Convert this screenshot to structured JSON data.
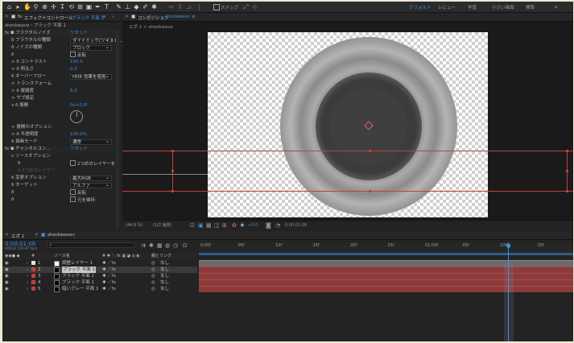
{
  "colors": {
    "accent": "#3a8ee6",
    "label_red": "#c04040",
    "label_white": "#e0e0e0",
    "bar": "#8c3a3a",
    "bar_top": "#6a6a6a"
  },
  "toolbar": {
    "snap_label": "スナップ",
    "workspaces": [
      "デフォルト",
      "レビュー",
      "学習",
      "小さい画面",
      "標準"
    ],
    "active_workspace_index": 0
  },
  "effect_controls": {
    "tab_label": "エフェクトコントロール",
    "tab_layer": "ブラック 平面 1",
    "breadcrumb": "shockwave・ブラック 平面 1",
    "rows": [
      {
        "indent": 0,
        "label": "fx 🞕 フラクタルノイズ",
        "value": "リセット",
        "type": "header"
      },
      {
        "indent": 1,
        "label": "ð フラクタルの種類",
        "value": "ダイナミック(ツイスト…",
        "type": "dropdown"
      },
      {
        "indent": 1,
        "label": "ð ノイズの種類",
        "value": "ブロック",
        "type": "dropdown"
      },
      {
        "indent": 1,
        "label": "ð",
        "value": "反転",
        "type": "checkbox"
      },
      {
        "indent": 1,
        "label": "> ð コントラスト",
        "value": "100.0",
        "type": "value"
      },
      {
        "indent": 1,
        "label": "> ð 明るさ",
        "value": "0.0",
        "type": "value"
      },
      {
        "indent": 1,
        "label": "ð オーバーフロー",
        "value": "HDR 効果を使用",
        "type": "dropdown"
      },
      {
        "indent": 1,
        "label": "> トランスフォーム",
        "value": "",
        "type": "group"
      },
      {
        "indent": 1,
        "label": "> ð 複雑度",
        "value": "6.0",
        "type": "value"
      },
      {
        "indent": 1,
        "label": "> サブ設定",
        "value": "",
        "type": "group"
      },
      {
        "indent": 1,
        "label": "v ð 展開",
        "value": "0x+0.0°",
        "type": "value"
      },
      {
        "indent": 1,
        "label": "",
        "value": "",
        "type": "dial"
      },
      {
        "indent": 1,
        "label": "> 展開のオプション",
        "value": "",
        "type": "group"
      },
      {
        "indent": 1,
        "label": "> ð 不透明度",
        "value": "100.0%",
        "type": "value"
      },
      {
        "indent": 1,
        "label": "ð 描画モード",
        "value": "通常",
        "type": "dropdown"
      },
      {
        "indent": 0,
        "label": "fx 🞕 チャンネルコン…",
        "value": "リセット",
        "type": "header"
      },
      {
        "indent": 1,
        "label": "v ソースオプション",
        "value": "",
        "type": "group"
      },
      {
        "indent": 2,
        "label": "ð",
        "value": "2つめのレイヤーを",
        "type": "checkbox"
      },
      {
        "indent": 2,
        "label": "ð 2つめのレイヤー",
        "value": "",
        "type": "disabled"
      },
      {
        "indent": 1,
        "label": "ð 変更オプション",
        "value": "最大RGB",
        "type": "dropdown"
      },
      {
        "indent": 1,
        "label": "ð ターゲット",
        "value": "アルファ",
        "type": "dropdown"
      },
      {
        "indent": 1,
        "label": "ð",
        "value": "反転",
        "type": "checkbox"
      },
      {
        "indent": 1,
        "label": "ð",
        "value": "元を維持",
        "type": "checkbox"
      }
    ]
  },
  "composition": {
    "tab_label": "コンポジション",
    "tab_comp": "shockwave",
    "breadcrumb": "エポ 1 > shockwave",
    "status": {
      "zoom": "(44.9 %)",
      "resolution": "(1/2 画質)",
      "timecode": "0;00;01;08",
      "exposure": "+0.0"
    }
  },
  "timeline": {
    "tabs": [
      "エポ 1",
      "shockwave"
    ],
    "timecode": "0;00;01;08",
    "timecode_sub": "00032 (29.97 fps)",
    "columns": {
      "source": "ソース名",
      "switches": "# ✱ ＼ fx ▦ ◕ ◎ ◐",
      "parent": "親とリンク"
    },
    "layers": [
      {
        "num": "1",
        "name": "調整レイヤー 1",
        "chip": "#e0e0e0",
        "parent": "なし",
        "selected": false
      },
      {
        "num": "2",
        "name": "ブラック 平面 1",
        "chip": "#c04040",
        "parent": "なし",
        "selected": true
      },
      {
        "num": "3",
        "name": "ブラック 平面 1",
        "chip": "#c04040",
        "parent": "なし",
        "selected": false
      },
      {
        "num": "4",
        "name": "ブラック 平面 1",
        "chip": "#c04040",
        "parent": "なし",
        "selected": false
      },
      {
        "num": "5",
        "name": "暗いグレー 平面 1",
        "chip": "#c04040",
        "parent": "なし",
        "selected": false
      }
    ],
    "ruler": [
      "0;00f",
      "05f",
      "10f",
      "15f",
      "20f",
      "25f",
      "01;00f",
      "05f",
      "10f",
      "15f"
    ],
    "playhead_fraction": 0.826
  }
}
